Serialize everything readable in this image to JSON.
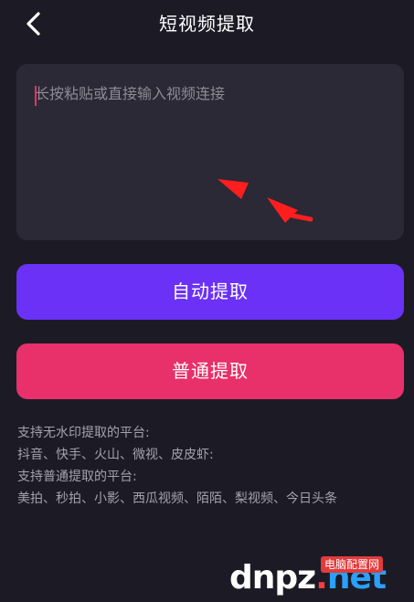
{
  "header": {
    "title": "短视频提取"
  },
  "input": {
    "placeholder": "长按粘贴或直接输入视频连接",
    "value": ""
  },
  "buttons": {
    "auto_extract": "自动提取",
    "normal_extract": "普通提取"
  },
  "info": {
    "lines": [
      "支持无水印提取的平台:",
      "抖音、快手、火山、微视、皮皮虾:",
      "支持普通提取的平台:",
      "美拍、秒拍、小影、西瓜视频、陌陌、梨视频、今日头条"
    ]
  },
  "watermark": {
    "logo_part1": "dn",
    "logo_part2": "pz",
    "logo_dot": ".",
    "logo_tld": "net",
    "badge": "电脑配置网"
  },
  "colors": {
    "background": "#1c1b25",
    "input_background": "#2a2935",
    "auto_button": "#6b31f6",
    "normal_button": "#e8306a",
    "annotation_arrow": "#ff1e1e",
    "info_text": "#a3a2ad"
  },
  "icons": {
    "back": "chevron-left-icon",
    "annotation": "red-arrow-icon"
  }
}
